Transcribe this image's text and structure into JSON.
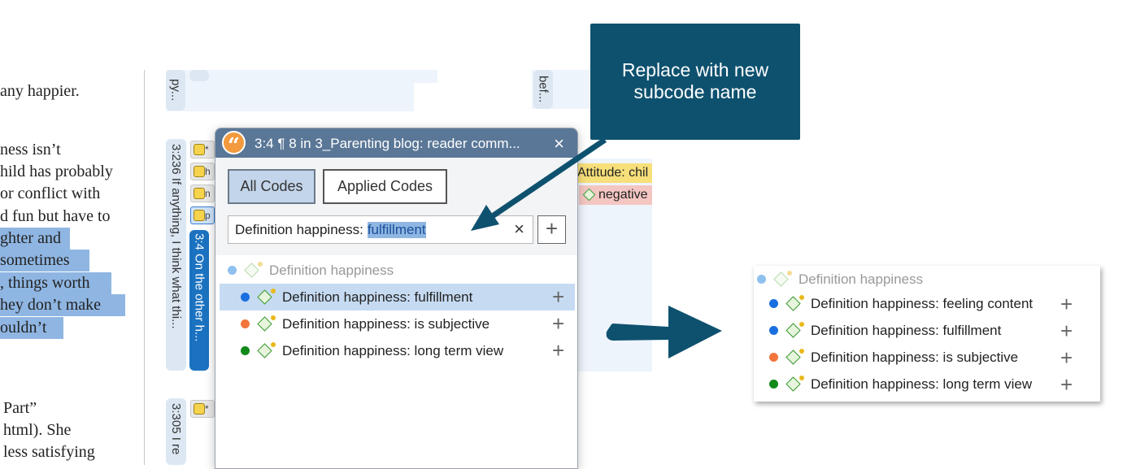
{
  "document": {
    "lines": [
      {
        "text": "any happier.",
        "highlighted": false
      },
      {
        "text": "ness isn’t",
        "highlighted": false
      },
      {
        "text": "hild has probably",
        "highlighted": false
      },
      {
        "text": "or conflict with",
        "highlighted": false
      },
      {
        "text": "d fun but have to",
        "highlighted": false
      },
      {
        "text": "ghter and",
        "highlighted": true
      },
      {
        "text": "sometimes",
        "highlighted": true
      },
      {
        "text": ", things worth",
        "highlighted": true
      },
      {
        "text": "hey don’t make",
        "highlighted": true
      },
      {
        "text": "ouldn’t",
        "highlighted": true
      },
      {
        "text": "Part”",
        "highlighted": false
      },
      {
        "text": "html). She",
        "highlighted": false
      },
      {
        "text": "less satisfying",
        "highlighted": false
      }
    ]
  },
  "margin": {
    "tags": [
      {
        "label": "py..."
      },
      {
        "label": "bef..."
      },
      {
        "label": "3:236 If anything, I think what thi..."
      },
      {
        "label": "3:4 On the other h..."
      },
      {
        "label": "3:305 I re"
      }
    ],
    "mini_chips": [
      "*",
      "h",
      "n",
      "p",
      "*"
    ],
    "code_chips": [
      {
        "label": "Attitude: chil",
        "color": "#f7df7a"
      },
      {
        "label": "negative",
        "color": "#f4c6c2"
      }
    ]
  },
  "popup": {
    "title": "3:4 ¶ 8 in 3_Parenting blog: reader comm...",
    "close_icon": "×",
    "tabs": [
      {
        "label": "All Codes",
        "active": true
      },
      {
        "label": "Applied Codes",
        "active": false
      }
    ],
    "search": {
      "prefix": "Definition happiness: ",
      "selected": "fulfillment",
      "clear_icon": "×"
    },
    "add_icon": "+",
    "parent_code": "Definition happiness",
    "codes": [
      {
        "label": "Definition happiness: fulfillment",
        "color": "#1a6fe0",
        "selected": true
      },
      {
        "label": "Definition happiness: is subjective",
        "color": "#f2763b",
        "selected": false
      },
      {
        "label": "Definition happiness: long term view",
        "color": "#118a1a",
        "selected": false
      }
    ]
  },
  "callout": {
    "line1": "Replace with new",
    "line2": "subcode name"
  },
  "result": {
    "parent_code": "Definition happiness",
    "codes": [
      {
        "label": "Definition happiness: feeling content",
        "color": "#1a6fe0"
      },
      {
        "label": "Definition happiness: fulfillment",
        "color": "#1a6fe0"
      },
      {
        "label": "Definition happiness: is subjective",
        "color": "#f2763b"
      },
      {
        "label": "Definition happiness: long term view",
        "color": "#118a1a"
      }
    ],
    "add_icon": "+"
  },
  "colors": {
    "header": "#5a7797",
    "callout": "#0e516f",
    "selection": "#8fb6e2",
    "selected_row": "#c6dbf2"
  }
}
